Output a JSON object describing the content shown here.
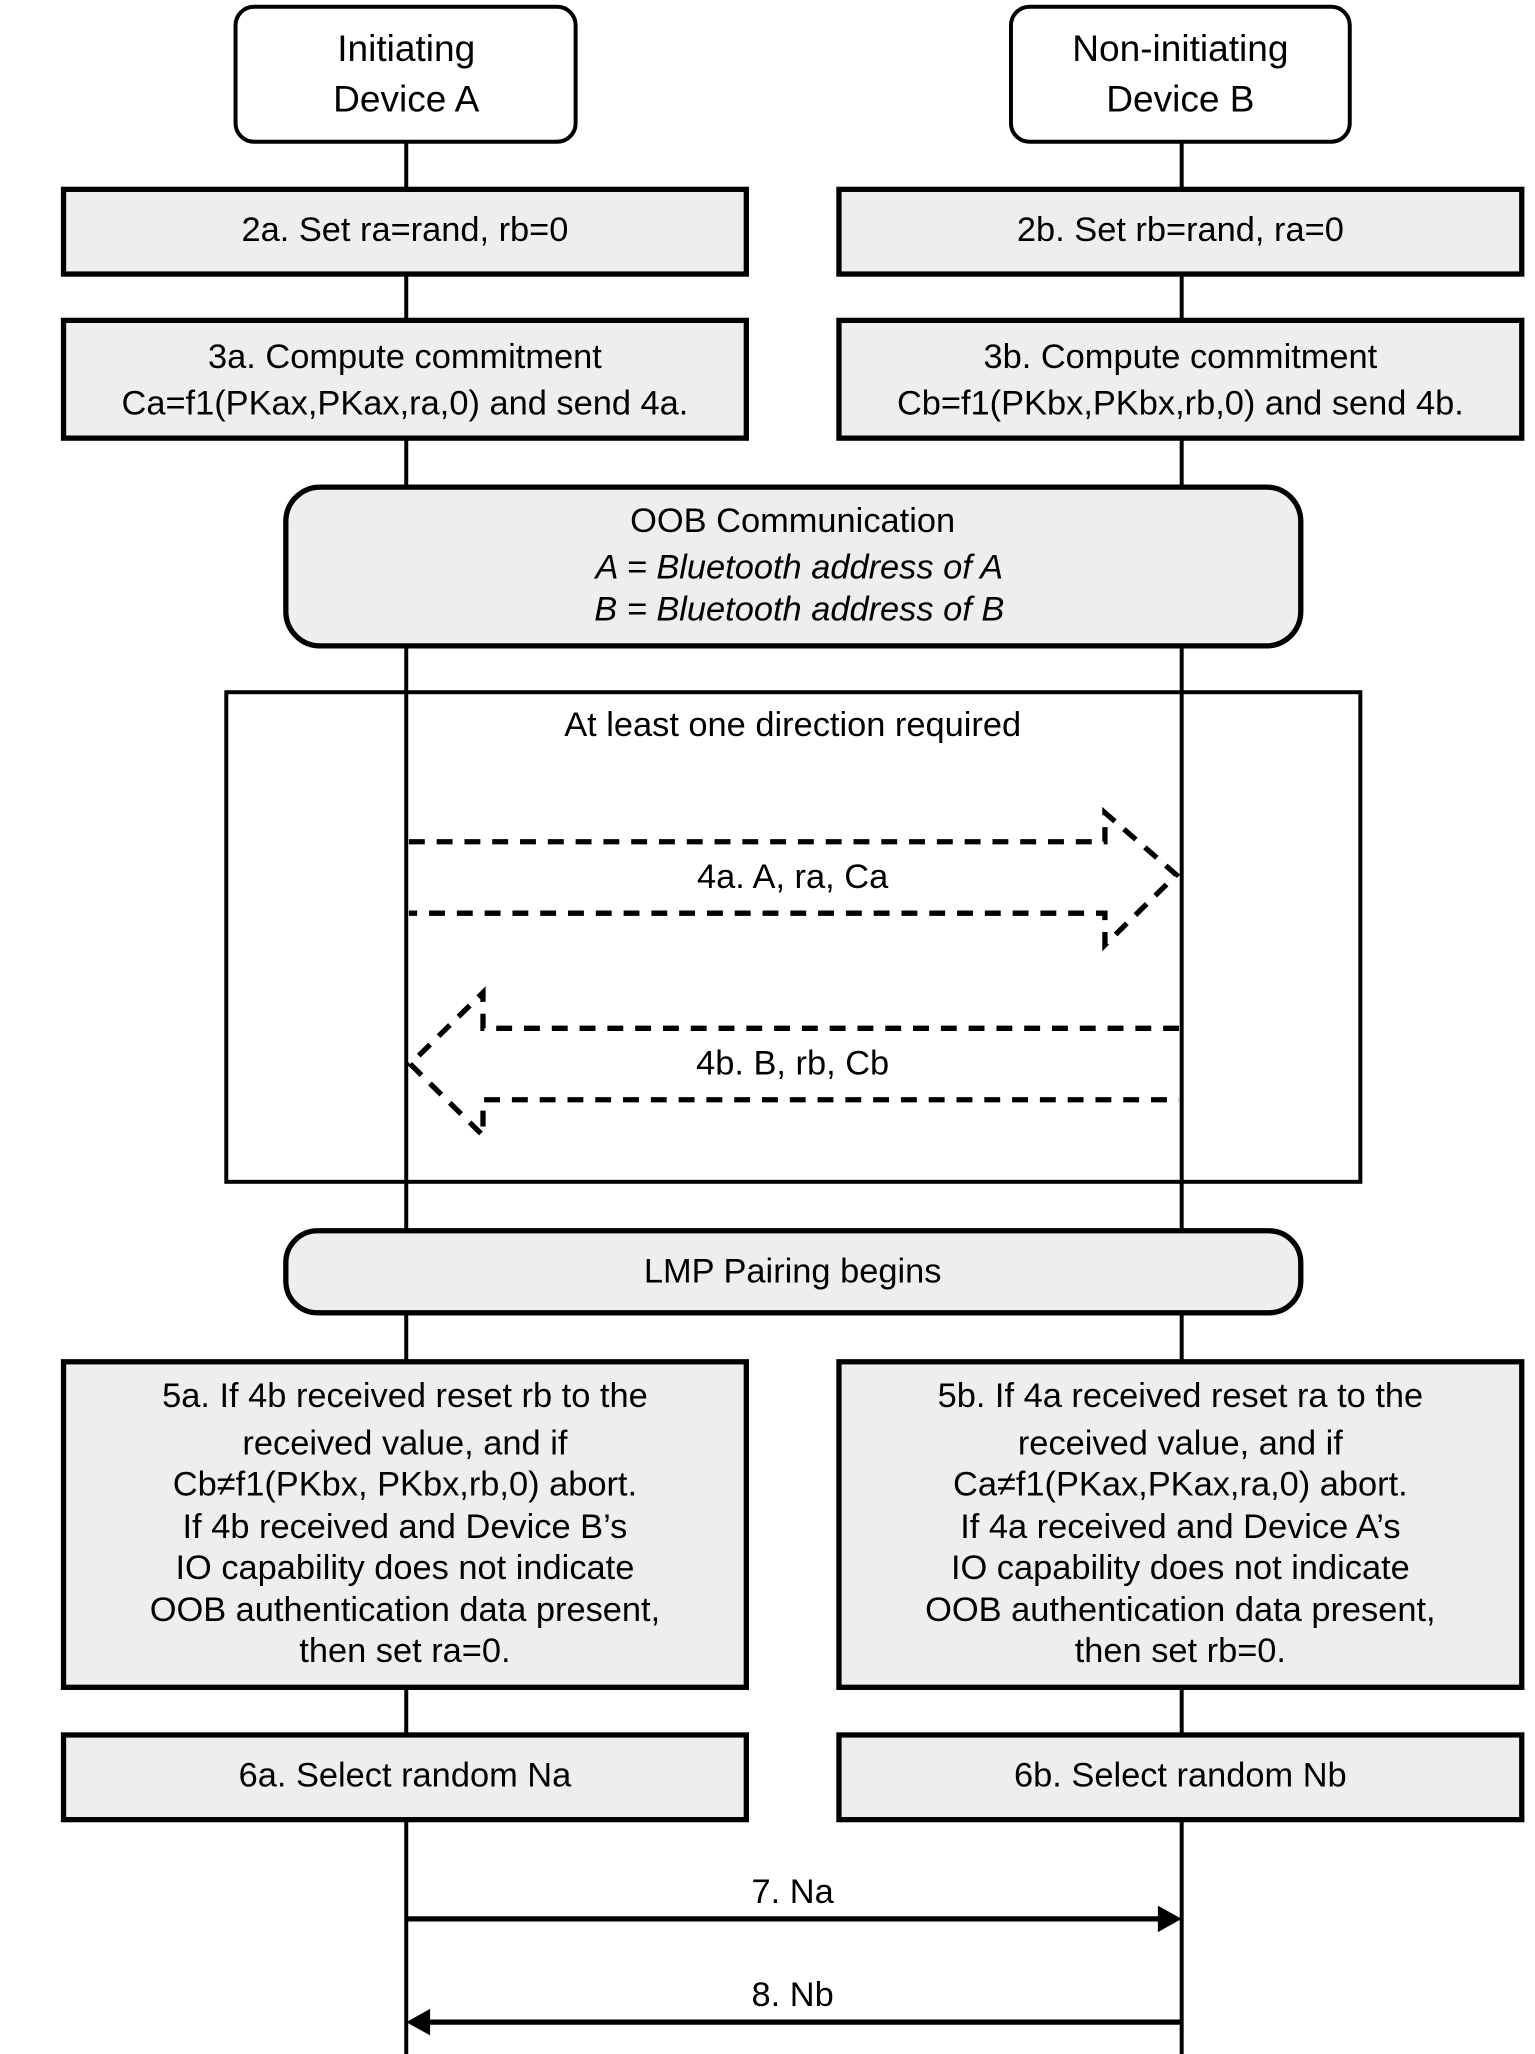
{
  "devices": {
    "a": {
      "line1": "Initiating",
      "line2": "Device A"
    },
    "b": {
      "line1": "Non-initiating",
      "line2": "Device B"
    }
  },
  "steps": {
    "s2a": [
      "2a.  Set ra=rand, rb=0"
    ],
    "s2b": [
      "2b.  Set rb=rand, ra=0"
    ],
    "s3a": [
      "3a.  Compute commitment",
      "Ca=f1(PKax,PKax,ra,0) and send 4a."
    ],
    "s3b": [
      "3b.  Compute commitment",
      "Cb=f1(PKbx,PKbx,rb,0) and send 4b."
    ],
    "s5a": [
      "5a.  If 4b received reset rb to the",
      "received value, and if",
      "Cb≠f1(PKbx, PKbx,rb,0) abort.",
      "If 4b received and Device B’s",
      "IO capability does not indicate",
      "OOB authentication data present,",
      "then set ra=0."
    ],
    "s5b": [
      "5b.  If 4a received reset ra to the",
      "received value, and if",
      "Ca≠f1(PKax,PKax,ra,0) abort.",
      "If 4a received and Device A’s",
      "IO capability does not indicate",
      "OOB authentication data present,",
      "then set rb=0."
    ],
    "s6a": [
      "6a.  Select random Na"
    ],
    "s6b": [
      "6b.  Select random Nb"
    ]
  },
  "oob": {
    "title": "OOB Communication",
    "line_a": "A = Bluetooth address of A",
    "line_b": "B = Bluetooth address of B"
  },
  "frame_label": "At least one direction required",
  "messages": {
    "m4a": "4a.  A, ra, Ca",
    "m4b": "4b.  B, rb, Cb",
    "m7": "7.  Na",
    "m8": "8.  Nb"
  },
  "lmp": "LMP Pairing begins"
}
